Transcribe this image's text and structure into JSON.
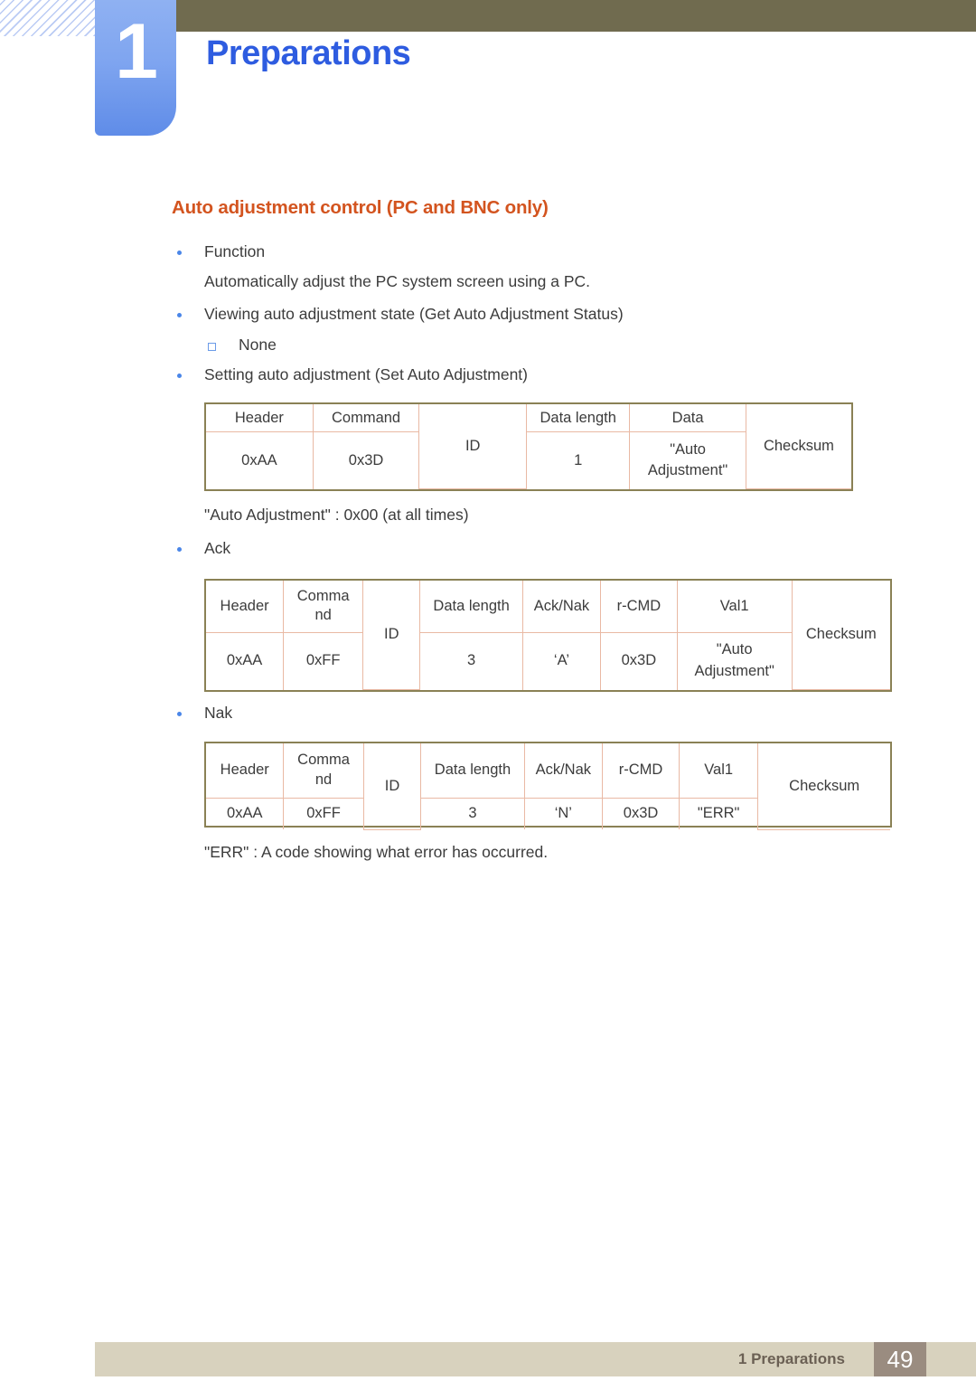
{
  "header": {
    "chapter_number": "1",
    "chapter_title": "Preparations",
    "olive_color": "#706B4F",
    "tab_color": "#7FA5F0",
    "title_color": "#2E5CE0"
  },
  "section": {
    "heading": "Auto adjustment control (PC and BNC only)",
    "heading_color": "#D3541F"
  },
  "body": {
    "b1_label": "Function",
    "b1_desc": "Automatically adjust the PC system screen using a PC.",
    "b2_label": "Viewing auto adjustment state (Get Auto Adjustment Status)",
    "b2_sub": "None",
    "b3_label": "Setting auto adjustment (Set Auto Adjustment)",
    "note1": "\"Auto Adjustment\" : 0x00 (at all times)",
    "b4_label": "Ack",
    "b5_label": "Nak",
    "note2": "\"ERR\" : A code showing what error has occurred."
  },
  "table_set": {
    "headers": [
      "Header",
      "Command",
      "ID",
      "Data length",
      "Data",
      "Checksum"
    ],
    "values": [
      "0xAA",
      "0x3D",
      "1",
      "\"Auto Adjustment\""
    ]
  },
  "table_ack": {
    "headers": [
      "Header",
      "Comma nd",
      "ID",
      "Data length",
      "Ack/Nak",
      "r-CMD",
      "Val1",
      "Checksum"
    ],
    "header_command": "Comma\nnd",
    "values": [
      "0xAA",
      "0xFF",
      "3",
      "‘A’",
      "0x3D",
      "\"Auto Adjustment\""
    ]
  },
  "table_nak": {
    "headers": [
      "Header",
      "Comma nd",
      "ID",
      "Data length",
      "Ack/Nak",
      "r-CMD",
      "Val1",
      "Checksum"
    ],
    "header_command": "Comma\nnd",
    "values": [
      "0xAA",
      "0xFF",
      "3",
      "‘N’",
      "0x3D",
      "\"ERR\""
    ]
  },
  "footer": {
    "label": "1 Preparations",
    "page": "49",
    "bar_color": "#D8D2BE",
    "page_box_color": "#9A8C80"
  }
}
